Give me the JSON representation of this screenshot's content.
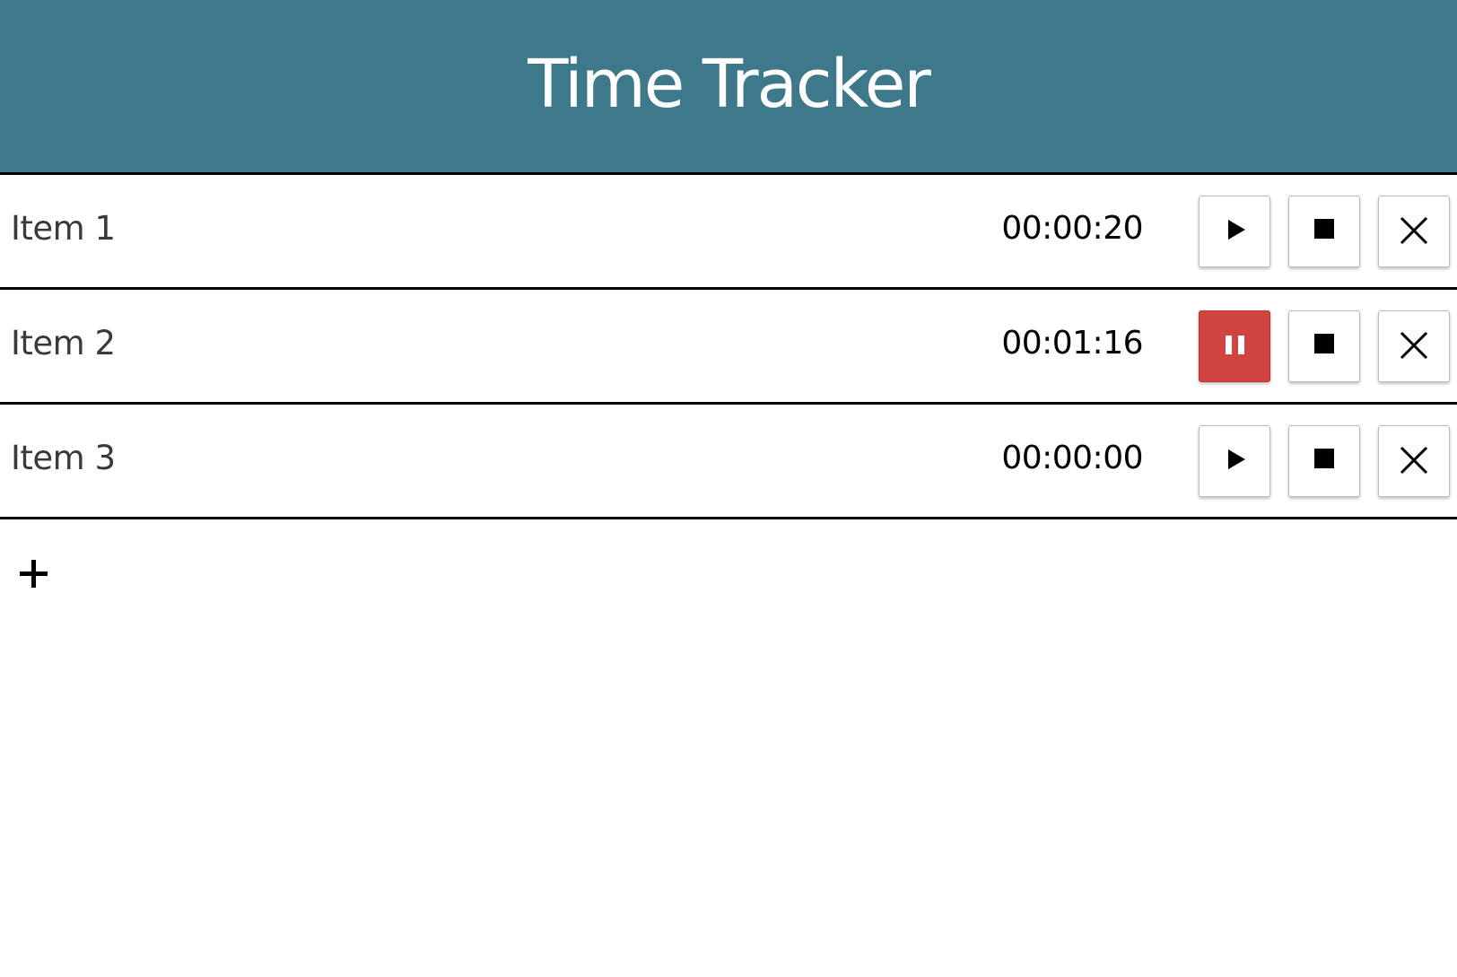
{
  "header": {
    "title": "Time Tracker",
    "background_color": "#3e798b"
  },
  "items": [
    {
      "name": "Item 1",
      "time": "00:00:20",
      "state": "stopped",
      "primary_icon": "play-icon"
    },
    {
      "name": "Item 2",
      "time": "00:01:16",
      "state": "running",
      "primary_icon": "pause-icon"
    },
    {
      "name": "Item 3",
      "time": "00:00:00",
      "state": "stopped",
      "primary_icon": "play-icon"
    }
  ],
  "icons": {
    "stop": "stop-icon",
    "remove": "close-icon",
    "add": "plus-icon"
  },
  "colors": {
    "running_button": "#d24441",
    "divider": "#000000"
  }
}
